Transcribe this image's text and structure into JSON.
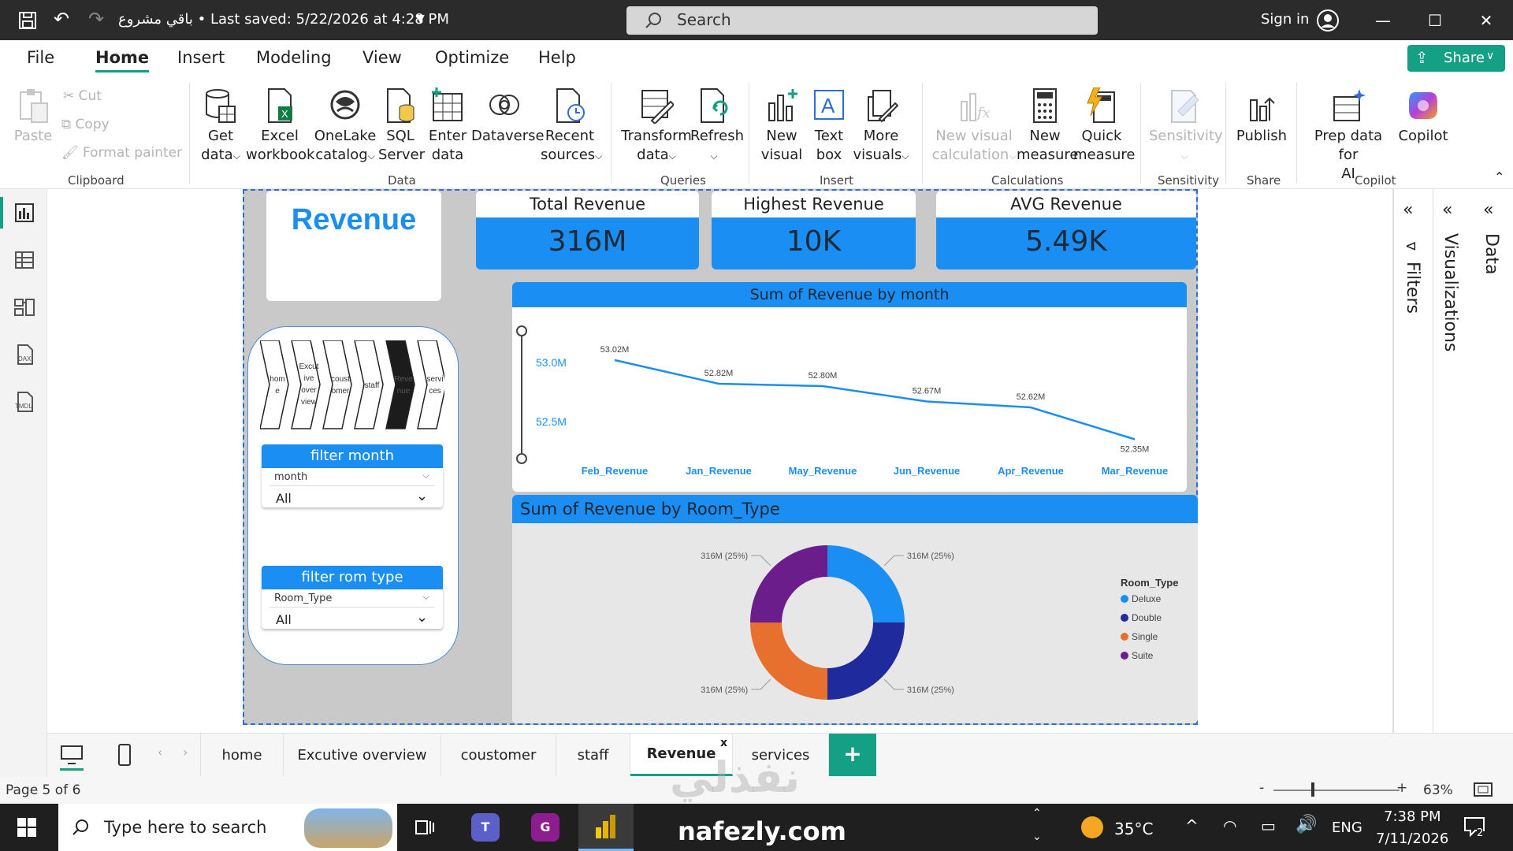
{
  "app": {
    "title": "باقي مشروع • Last saved: 5/22/2026 at 4:28 PM",
    "search_placeholder": "Search",
    "sign_in": "Sign in",
    "accent": "#1b8ef3",
    "share_color": "#13a085"
  },
  "menu": [
    "File",
    "Home",
    "Insert",
    "Modeling",
    "View",
    "Optimize",
    "Help"
  ],
  "active_menu": "Home",
  "share_label": "Share",
  "ribbon": {
    "clipboard": {
      "paste": "Paste",
      "cut": "Cut",
      "copy": "Copy",
      "format_painter": "Format painter",
      "group": "Clipboard"
    },
    "data": {
      "get_data_1": "Get",
      "get_data_2": "data",
      "excel_1": "Excel",
      "excel_2": "workbook",
      "onelake_1": "OneLake",
      "onelake_2": "catalog",
      "sql_1": "SQL",
      "sql_2": "Server",
      "enter_1": "Enter",
      "enter_2": "data",
      "dataverse": "Dataverse",
      "recent_1": "Recent",
      "recent_2": "sources",
      "group": "Data"
    },
    "queries": {
      "transform_1": "Transform",
      "transform_2": "data",
      "refresh": "Refresh",
      "group": "Queries"
    },
    "insert": {
      "newvisual_1": "New",
      "newvisual_2": "visual",
      "textbox_1": "Text",
      "textbox_2": "box",
      "more_1": "More",
      "more_2": "visuals",
      "group": "Insert"
    },
    "calculations": {
      "nvc_1": "New visual",
      "nvc_2": "calculation",
      "nm_1": "New",
      "nm_2": "measure",
      "qm_1": "Quick",
      "qm_2": "measure",
      "group": "Calculations"
    },
    "sensitivity": {
      "label": "Sensitivity",
      "group": "Sensitivity"
    },
    "share": {
      "publish": "Publish",
      "group": "Share"
    },
    "copilot": {
      "prep_1": "Prep data for",
      "prep_2": "AI",
      "copilot": "Copilot",
      "group": "Copilot"
    }
  },
  "report": {
    "title": "Revenue",
    "kpis": [
      {
        "label": "Total Revenue",
        "value": "316M"
      },
      {
        "label": "Highest Revenue",
        "value": "10K"
      },
      {
        "label": "AVG Revenue",
        "value": "5.49K"
      }
    ],
    "nav_buttons": [
      "hom e",
      "Excut ive over view",
      "coust omer",
      "staff",
      "Reve nue",
      "servi ces"
    ],
    "slicers": [
      {
        "title": "filter month",
        "field": "month",
        "value": "All"
      },
      {
        "title": "filter rom type",
        "field": "Room_Type",
        "value": "All"
      }
    ]
  },
  "chart_data": [
    {
      "type": "line",
      "title": "Sum of Revenue by month",
      "categories": [
        "Feb_Revenue",
        "Jan_Revenue",
        "May_Revenue",
        "Jun_Revenue",
        "Apr_Revenue",
        "Mar_Revenue"
      ],
      "values": [
        53.02,
        52.82,
        52.8,
        52.67,
        52.62,
        52.35
      ],
      "data_labels": [
        "53.02M",
        "52.82M",
        "52.80M",
        "52.67M",
        "52.62M",
        "52.35M"
      ],
      "y_ticks": [
        "53.0M",
        "52.5M"
      ],
      "ylim": [
        52.2,
        53.2
      ],
      "color": "#1b8ef3"
    },
    {
      "type": "pie",
      "title": "Sum of Revenue by Room_Type",
      "legend_title": "Room_Type",
      "labels": [
        "Deluxe",
        "Double",
        "Single",
        "Suite"
      ],
      "values": [
        25,
        25,
        25,
        25
      ],
      "data_labels": [
        "316M (25%)",
        "316M (25%)",
        "316M (25%)",
        "316M (25%)"
      ],
      "colors": [
        "#1b8ef3",
        "#1f2a9c",
        "#e8702e",
        "#6b1d8c"
      ],
      "legend_position": "right"
    }
  ],
  "right_panes": [
    "Filters",
    "Visualizations",
    "Data"
  ],
  "page_tabs": [
    "home",
    "Excutive overview",
    "coustomer",
    "staff",
    "Revenue",
    "services"
  ],
  "active_tab": "Revenue",
  "add_tab": "+",
  "status": {
    "page": "Page 5 of 6",
    "zoom": "63%"
  },
  "taskbar": {
    "search": "Type here to search",
    "temp": "35°C",
    "lang": "ENG",
    "time": "7:38 PM",
    "date": "7/11/2026",
    "watermark": "نفذلي",
    "watermark_url": "nafezly.com",
    "notif": "2"
  }
}
